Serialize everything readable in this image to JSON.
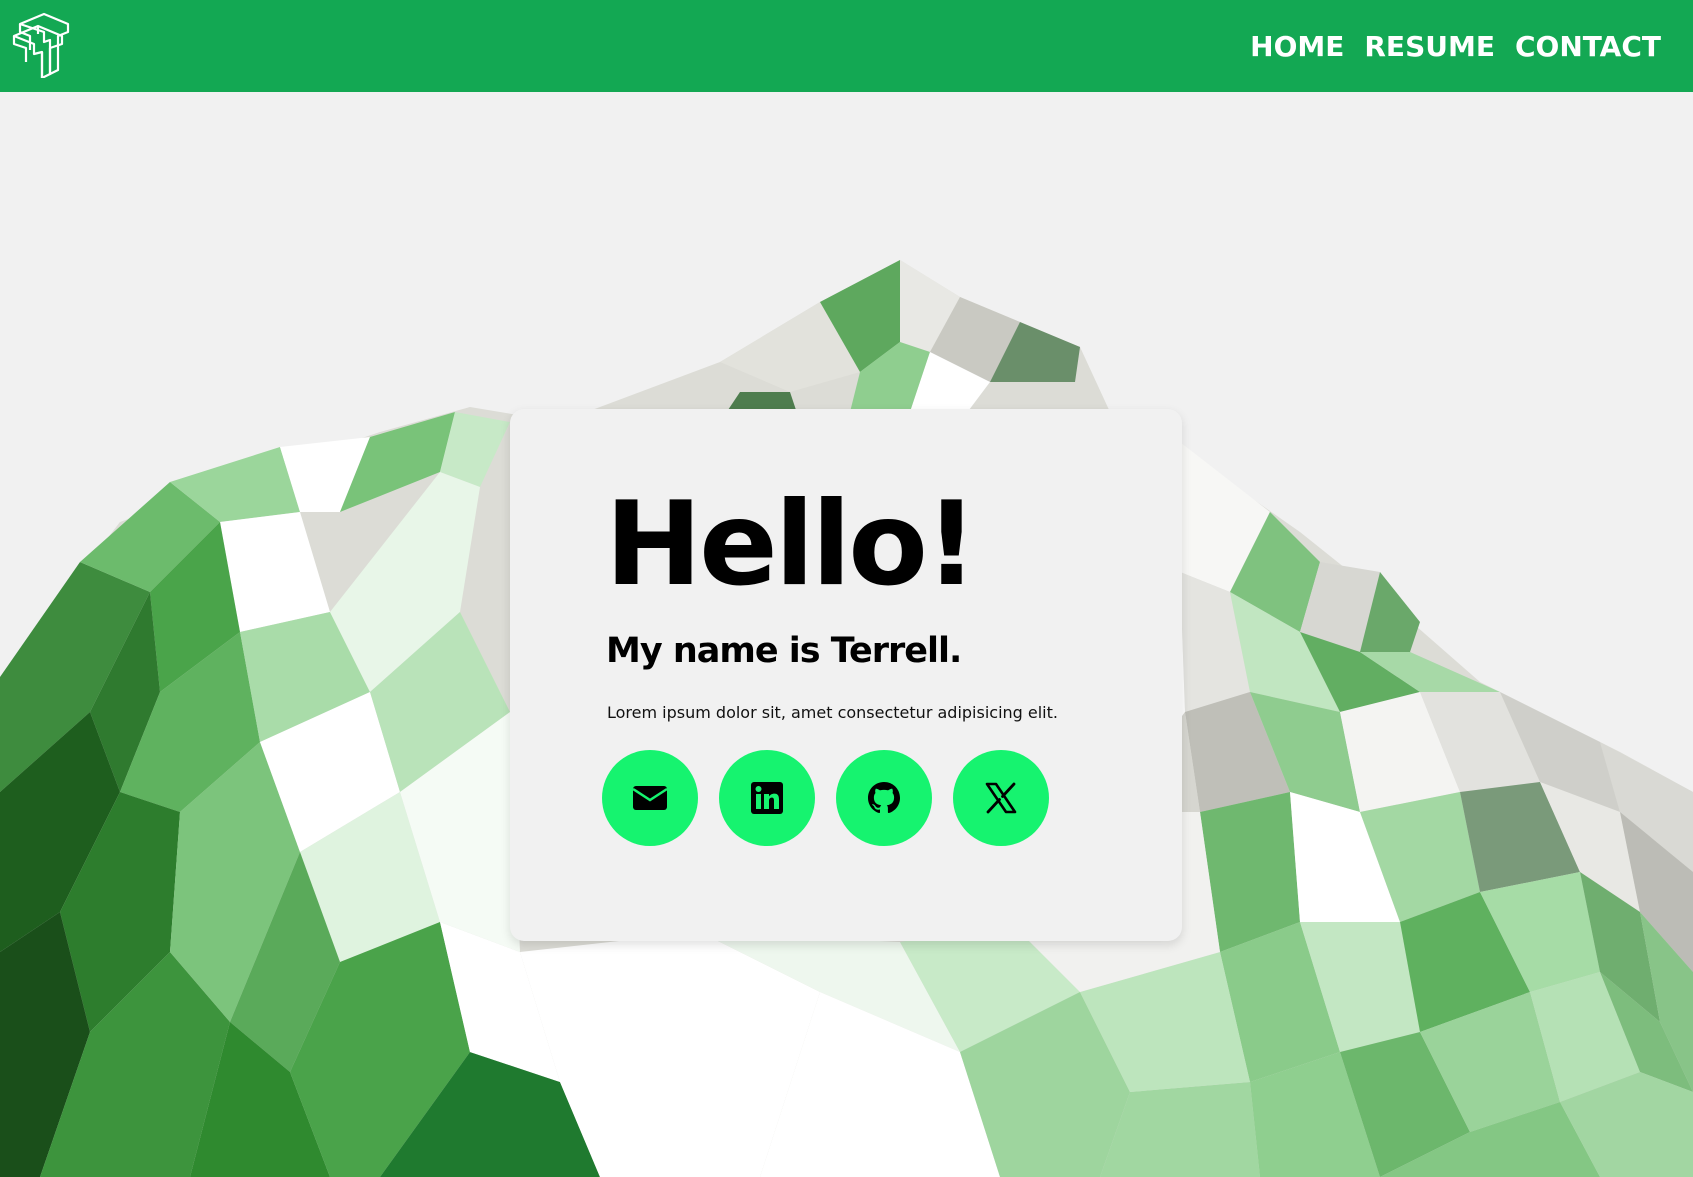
{
  "colors": {
    "nav_background": "#13a853",
    "nav_text": "#ffffff",
    "page_background": "#f1f1f1",
    "social_button": "#16f36f",
    "text": "#000000"
  },
  "header": {
    "logo_icon": "tt-monogram-logo-icon",
    "nav": [
      {
        "label": "HOME"
      },
      {
        "label": "RESUME"
      },
      {
        "label": "CONTACT"
      }
    ]
  },
  "hero": {
    "background_image": "low-poly-green-mountain-illustration",
    "heading": "Hello!",
    "subheading": "My name is Terrell.",
    "description": "Lorem ipsum dolor sit, amet consectetur adipisicing elit.",
    "social_links": [
      {
        "icon": "email-icon"
      },
      {
        "icon": "linkedin-icon"
      },
      {
        "icon": "github-icon"
      },
      {
        "icon": "x-twitter-icon"
      }
    ]
  }
}
